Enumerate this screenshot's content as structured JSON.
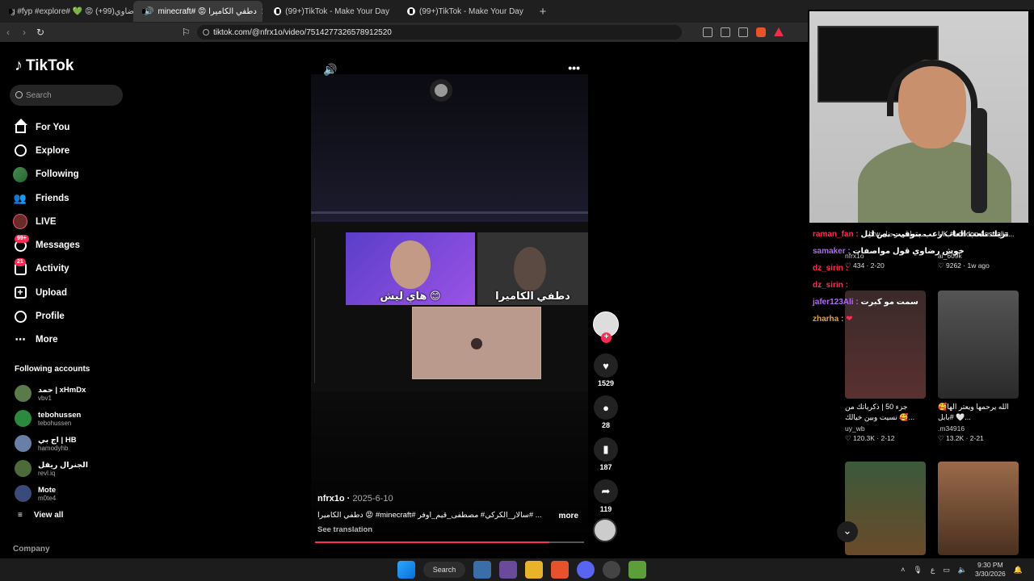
{
  "browser": {
    "tabs": [
      {
        "label": "g #fyp #explore# 💚 😡 رضاوي(99+)"
      },
      {
        "label": "minecraft# 😡 دطفي الكاميرا",
        "active": true
      },
      {
        "label": "(99+)TikTok - Make Your Day"
      },
      {
        "label": "(99+)TikTok - Make Your Day"
      }
    ],
    "url": "tiktok.com/@nfrx1o/video/7514277326578912520"
  },
  "sidebar": {
    "logo": "TikTok",
    "search_placeholder": "Search",
    "nav": [
      {
        "label": "For You",
        "icon": "home-icon"
      },
      {
        "label": "Explore",
        "icon": "compass-icon"
      },
      {
        "label": "Following",
        "icon": "following-avatar-icon"
      },
      {
        "label": "Friends",
        "icon": "friends-icon"
      },
      {
        "label": "LIVE",
        "icon": "live-icon"
      },
      {
        "label": "Messages",
        "icon": "messages-icon",
        "badge": "99+"
      },
      {
        "label": "Activity",
        "icon": "activity-icon",
        "badge": "21"
      },
      {
        "label": "Upload",
        "icon": "upload-icon"
      },
      {
        "label": "Profile",
        "icon": "profile-icon"
      },
      {
        "label": "More",
        "icon": "more-icon"
      }
    ],
    "following_title": "Following accounts",
    "following": [
      {
        "name": "حمد | xHmDx",
        "handle": "vbv1"
      },
      {
        "name": "tebohussen",
        "handle": "tebohussen"
      },
      {
        "name": "اج بي | HB",
        "handle": "hamodyhb"
      },
      {
        "name": "الجنرال ريفل",
        "handle": "revl.iq"
      },
      {
        "name": "Mote",
        "handle": "m0te4"
      }
    ],
    "view_all": "View all",
    "company": "Company"
  },
  "video": {
    "cam1_label": "هاي ليش 😊",
    "cam2_label": "دطفي الكاميرا",
    "author": "nfrx1o",
    "date": "2025-6-10",
    "caption": "دطفي الكاميرا 😡 #minecraft# سالار_الكركي# مصطفى_قيم_اوفر# ...",
    "more": "more",
    "see_translation": "See translation",
    "progress": 0.87,
    "likes": "1529",
    "comments": "28",
    "saves": "187",
    "shares": "119"
  },
  "right": {
    "chat": [
      {
        "user": "raman_fan :",
        "msg": "تريك تلعب العاب رعب بتوقيت نص ليل"
      },
      {
        "user": "samaker :",
        "msg": "خوش رضاوي قول مواصفات"
      },
      {
        "user": "dz_sirin :",
        "msg": ""
      },
      {
        "user": "dz_sirin :",
        "msg": ""
      },
      {
        "user": "jafer123Ali :",
        "msg": "سمت مو كبرت"
      },
      {
        "user": "zharha :",
        "msg": "❤"
      }
    ],
    "cards": [
      {
        "title": "مصطفى رحيل btw",
        "user": "nfrx1o",
        "likes": "434",
        "date": "2-20"
      },
      {
        "title": "UK #London Australia...",
        "user": "ai_609k",
        "likes": "9262",
        "date": "1w ago"
      },
      {
        "title": "جزء 50 | ذكرياتك من نسيت وبين خيالك 🥰...",
        "user": "uy_wb",
        "likes": "120.3K",
        "date": "2-12"
      },
      {
        "title": "الله يرحمها ويعتر الها🥰 #بابل 🤍...",
        "user": ".m34916",
        "likes": "13.2K",
        "date": "2-21"
      }
    ]
  },
  "taskbar": {
    "search": "Search",
    "time": "9:30 PM",
    "date": "3/30/2026"
  }
}
